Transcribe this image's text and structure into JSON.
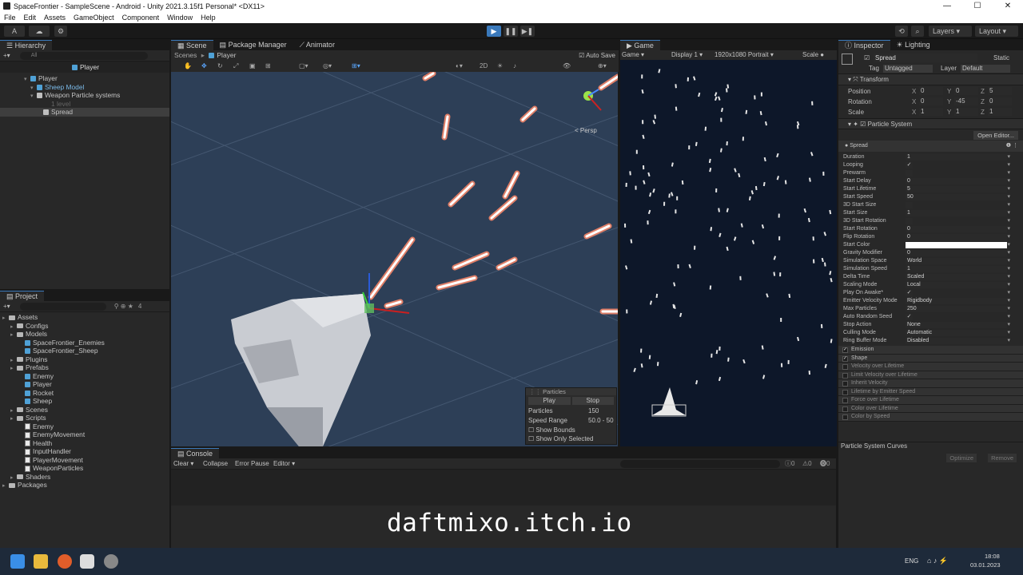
{
  "window": {
    "title": "SpaceFrontier - SampleScene - Android - Unity 2021.3.15f1 Personal* <DX11>",
    "controls": [
      "—",
      "☐",
      "✕"
    ]
  },
  "menu": [
    "File",
    "Edit",
    "Assets",
    "GameObject",
    "Component",
    "Window",
    "Help"
  ],
  "toolbar": {
    "account": "A",
    "layers": "Layers",
    "layout": "Layout"
  },
  "hierarchy": {
    "tab": "Hierarchy",
    "search_placeholder": "All",
    "root": "Player",
    "items": [
      {
        "label": "Player",
        "depth": 0,
        "icon": "cube"
      },
      {
        "label": "Sheep Model",
        "depth": 1,
        "icon": "cube"
      },
      {
        "label": "Weapon Particle systems",
        "depth": 1,
        "icon": "cube-white"
      },
      {
        "label": "1 level",
        "depth": 2,
        "icon": "none"
      },
      {
        "label": "Spread",
        "depth": 2,
        "icon": "cube-white",
        "selected": true
      }
    ]
  },
  "project": {
    "tab": "Project",
    "count": "4",
    "tree": [
      {
        "label": "Assets",
        "depth": 0,
        "icon": "folder"
      },
      {
        "label": "Configs",
        "depth": 1,
        "icon": "folder"
      },
      {
        "label": "Models",
        "depth": 1,
        "icon": "folder"
      },
      {
        "label": "SpaceFrontier_Enemies",
        "depth": 2,
        "icon": "cube"
      },
      {
        "label": "SpaceFrontier_Sheep",
        "depth": 2,
        "icon": "cube"
      },
      {
        "label": "Plugins",
        "depth": 1,
        "icon": "folder"
      },
      {
        "label": "Prefabs",
        "depth": 1,
        "icon": "folder"
      },
      {
        "label": "Enemy",
        "depth": 2,
        "icon": "cube"
      },
      {
        "label": "Player",
        "depth": 2,
        "icon": "cube"
      },
      {
        "label": "Rocket",
        "depth": 2,
        "icon": "cube"
      },
      {
        "label": "Sheep",
        "depth": 2,
        "icon": "cube"
      },
      {
        "label": "Scenes",
        "depth": 1,
        "icon": "folder"
      },
      {
        "label": "Scripts",
        "depth": 1,
        "icon": "folder"
      },
      {
        "label": "Enemy",
        "depth": 2,
        "icon": "script"
      },
      {
        "label": "EnemyMovement",
        "depth": 2,
        "icon": "script"
      },
      {
        "label": "Health",
        "depth": 2,
        "icon": "script"
      },
      {
        "label": "InputHandler",
        "depth": 2,
        "icon": "script"
      },
      {
        "label": "PlayerMovement",
        "depth": 2,
        "icon": "script"
      },
      {
        "label": "WeaponParticles",
        "depth": 2,
        "icon": "script"
      },
      {
        "label": "Shaders",
        "depth": 1,
        "icon": "folder"
      },
      {
        "label": "Packages",
        "depth": 0,
        "icon": "folder"
      }
    ]
  },
  "scene": {
    "tabs": [
      "Scene",
      "Package Manager",
      "Animator"
    ],
    "breadcrumb_root": "Scenes",
    "breadcrumb": "Player",
    "autosave": "Auto Save",
    "mode2d": "2D",
    "persp": "< Persp"
  },
  "particles_overlay": {
    "title": "Particles",
    "play": "Play",
    "stop": "Stop",
    "rows": [
      {
        "label": "Particles",
        "value": "150"
      },
      {
        "label": "Speed Range",
        "value": "50.0 - 50"
      }
    ],
    "checks": [
      "Show Bounds",
      "Show Only Selected"
    ]
  },
  "game": {
    "tab": "Game",
    "mode": "Game",
    "display": "Display 1",
    "resolution": "1920x1080 Portrait",
    "scale": "Scale"
  },
  "console": {
    "tab": "Console",
    "buttons": [
      "Clear",
      "Collapse",
      "Error Pause",
      "Editor"
    ],
    "counts": [
      "0",
      "0",
      "0"
    ]
  },
  "overlay_text": "daftmixo.itch.io",
  "inspector": {
    "tabs": [
      "Inspector",
      "Lighting"
    ],
    "name": "Spread",
    "static": "Static",
    "tag_label": "Tag",
    "tag": "Untagged",
    "layer_label": "Layer",
    "layer": "Default",
    "transform": {
      "title": "Transform",
      "rows": [
        {
          "label": "Position",
          "x": "0",
          "y": "0",
          "z": "5"
        },
        {
          "label": "Rotation",
          "x": "0",
          "y": "-45",
          "z": "0"
        },
        {
          "label": "Scale",
          "x": "1",
          "y": "1",
          "z": "1"
        }
      ]
    },
    "ps": {
      "title": "Particle System",
      "open_editor": "Open Editor...",
      "sub": "Spread",
      "rows": [
        {
          "label": "Duration",
          "value": "1"
        },
        {
          "label": "Looping",
          "value": "✓"
        },
        {
          "label": "Prewarm",
          "value": ""
        },
        {
          "label": "Start Delay",
          "value": "0"
        },
        {
          "label": "Start Lifetime",
          "value": "5"
        },
        {
          "label": "Start Speed",
          "value": "50"
        },
        {
          "label": "3D Start Size",
          "value": ""
        },
        {
          "label": "Start Size",
          "value": "1"
        },
        {
          "label": "3D Start Rotation",
          "value": ""
        },
        {
          "label": "Start Rotation",
          "value": "0"
        },
        {
          "label": "Flip Rotation",
          "value": "0"
        },
        {
          "label": "Start Color",
          "value": ""
        },
        {
          "label": "Gravity Modifier",
          "value": "0"
        },
        {
          "label": "Simulation Space",
          "value": "World"
        },
        {
          "label": "Simulation Speed",
          "value": "1"
        },
        {
          "label": "Delta Time",
          "value": "Scaled"
        },
        {
          "label": "Scaling Mode",
          "value": "Local"
        },
        {
          "label": "Play On Awake*",
          "value": "✓"
        },
        {
          "label": "Emitter Velocity Mode",
          "value": "Rigidbody"
        },
        {
          "label": "Max Particles",
          "value": "250"
        },
        {
          "label": "Auto Random Seed",
          "value": "✓"
        },
        {
          "label": "Stop Action",
          "value": "None"
        },
        {
          "label": "Culling Mode",
          "value": "Automatic"
        },
        {
          "label": "Ring Buffer Mode",
          "value": "Disabled"
        }
      ],
      "modules": [
        {
          "label": "Emission",
          "on": true
        },
        {
          "label": "Shape",
          "on": true
        },
        {
          "label": "Velocity over Lifetime",
          "on": false
        },
        {
          "label": "Limit Velocity over Lifetime",
          "on": false
        },
        {
          "label": "Inherit Velocity",
          "on": false
        },
        {
          "label": "Lifetime by Emitter Speed",
          "on": false
        },
        {
          "label": "Force over Lifetime",
          "on": false
        },
        {
          "label": "Color over Lifetime",
          "on": false
        },
        {
          "label": "Color by Speed",
          "on": false
        }
      ]
    },
    "curves": {
      "title": "Particle System Curves",
      "optimize": "Optimize",
      "remove": "Remove"
    }
  },
  "taskbar": {
    "lang": "ENG",
    "time": "18:08",
    "date": "03.01.2023"
  },
  "colors": {
    "accent": "#3a79bb",
    "scene_bg": "#2d3f57",
    "game_bg": "#0d1729"
  }
}
